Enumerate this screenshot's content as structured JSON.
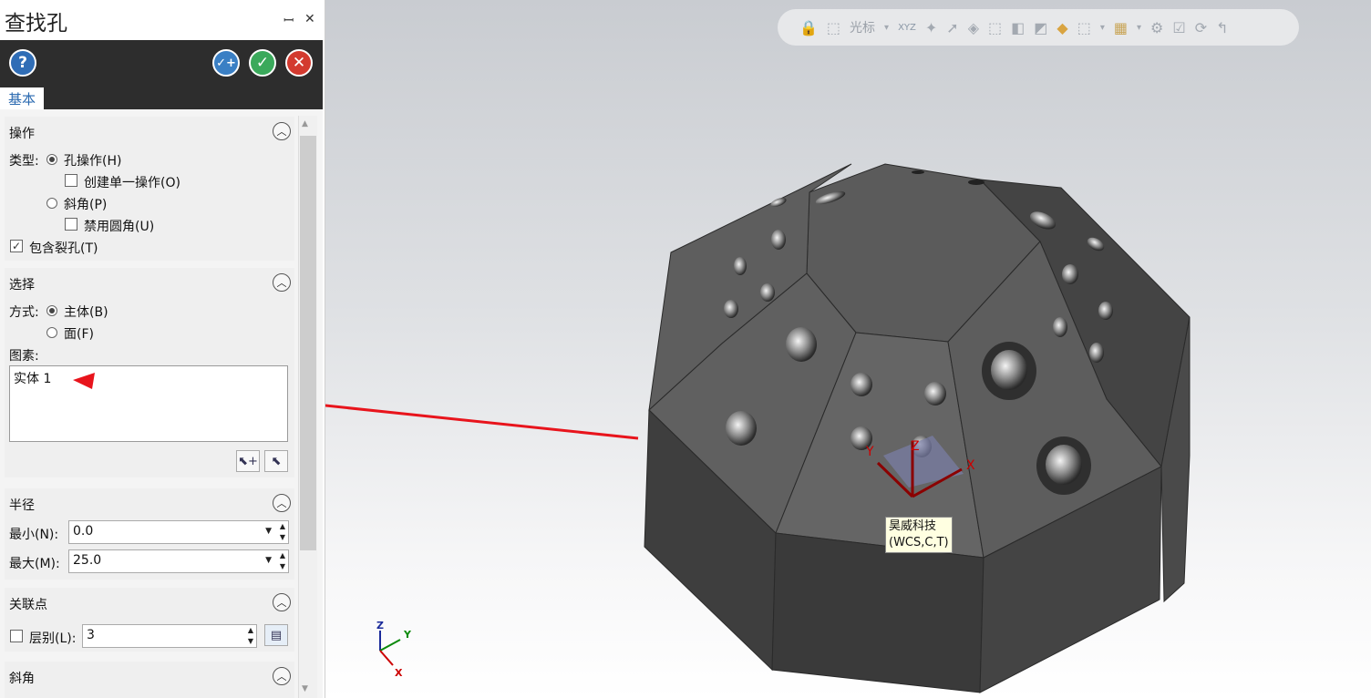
{
  "panel": {
    "title": "查找孔",
    "pin_glyph": "ꟷ",
    "close_glyph": "✕",
    "header": {
      "help_glyph": "?",
      "apply_glyph": "✓+",
      "ok_glyph": "✓",
      "cancel_glyph": "✕",
      "tab": "基本"
    },
    "operation": {
      "title": "操作",
      "type_label": "类型:",
      "radio_hole_op": "孔操作(H)",
      "check_single_op": "创建单一操作(O)",
      "radio_chamfer": "斜角(P)",
      "check_disable_fillet": "禁用圆角(U)",
      "check_include_split": "包含裂孔(T)",
      "include_split_checked": true,
      "hole_op_selected": true
    },
    "selection": {
      "title": "选择",
      "method_label": "方式:",
      "radio_body": "主体(B)",
      "radio_face": "面(F)",
      "body_selected": true,
      "elements_label": "图素:",
      "elements_value": "实体 1"
    },
    "radius": {
      "title": "半径",
      "min_label": "最小(N):",
      "min_value": "0.0",
      "max_label": "最大(M):",
      "max_value": "25.0"
    },
    "association": {
      "title": "关联点",
      "level_label": "层别(L):",
      "level_value": "3",
      "level_checked": false
    },
    "chamfer": {
      "title": "斜角"
    }
  },
  "viewport": {
    "toolbar": {
      "cursor_label": "光标",
      "xyz_label": "XYZ"
    },
    "tooltip": {
      "line1": "昊威科技",
      "line2": "(WCS,C,T)"
    },
    "gnomon": {
      "x": "X",
      "y": "Y",
      "z": "Z"
    },
    "triad": {
      "x": "X",
      "y": "Y",
      "z": "Z"
    }
  },
  "colors": {
    "arrow": "#e8141c",
    "panel_dark": "#2d2d2d",
    "accent_tab": "#2b6ab0"
  }
}
